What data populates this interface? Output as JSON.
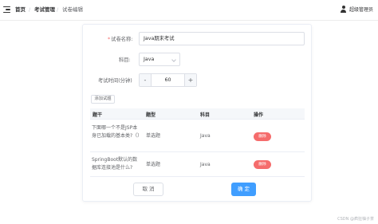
{
  "breadcrumb": {
    "items": [
      "首页",
      "考试管理",
      "试卷编辑"
    ],
    "separator": "/"
  },
  "user": {
    "name": "超级管理员"
  },
  "form": {
    "title_label": "试卷名称:",
    "title_required": "*",
    "title_value": "Java期末考试",
    "subject_label": "科目:",
    "subject_value": "Java",
    "duration_label": "考试时间(分钟)",
    "duration_minus": "-",
    "duration_plus": "+",
    "duration_value": "60",
    "add_question_label": "添加试题"
  },
  "table": {
    "headers": [
      "题干",
      "题型",
      "科目",
      "操作"
    ],
    "rows": [
      {
        "question": "下面哪一个不是JSP本身已加载的基本类?（）",
        "type": "单选题",
        "subject": "Java",
        "action": "删除"
      },
      {
        "question": "SpringBoot默认的数据库连接池是什么?",
        "type": "单选题",
        "subject": "Java",
        "action": "删除"
      }
    ]
  },
  "actions": {
    "cancel": "取 消",
    "confirm": "确 定"
  },
  "watermark": "CSDN @疯狂柚子茶",
  "colors": {
    "primary": "#409eff",
    "danger": "#f56c6c",
    "border": "#dcdfe6"
  }
}
